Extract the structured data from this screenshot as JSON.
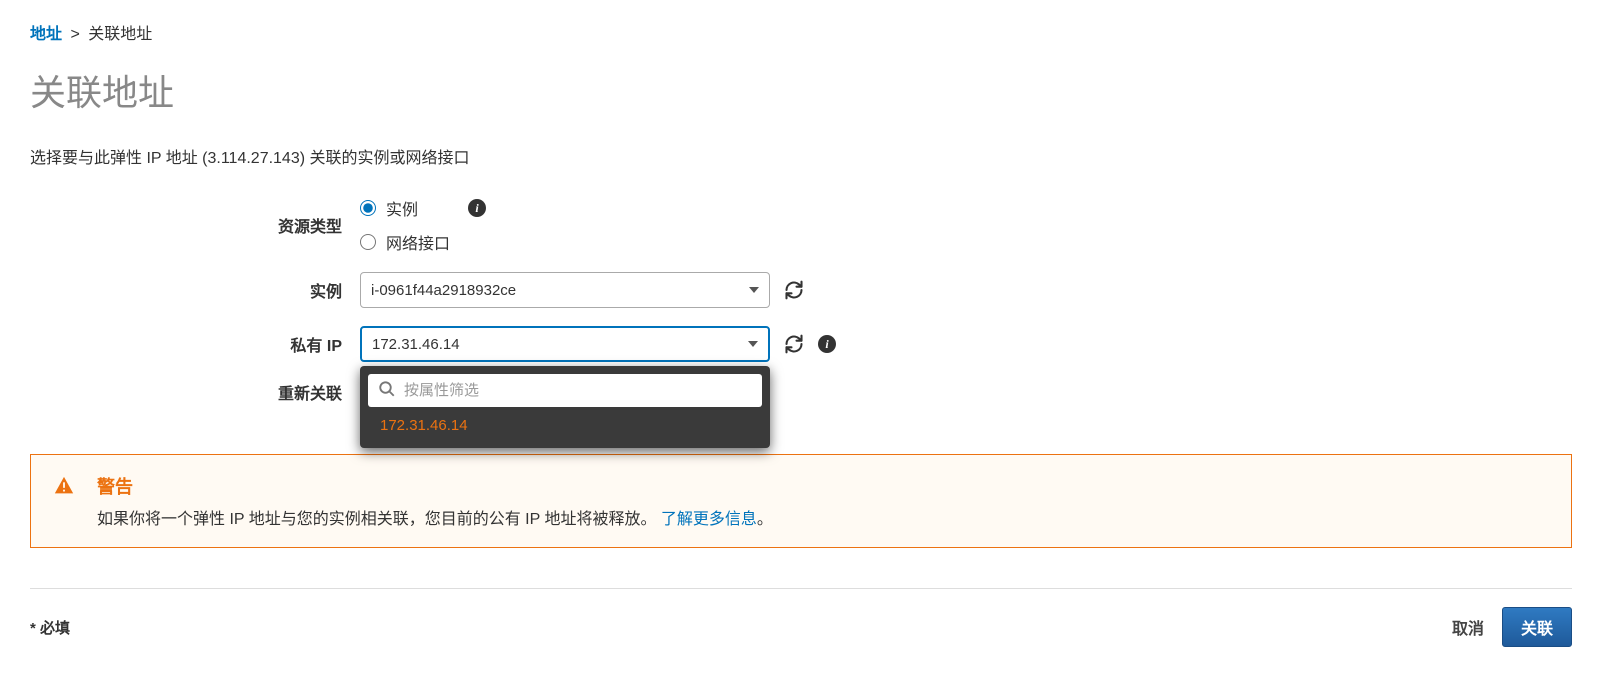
{
  "breadcrumb": {
    "root": "地址",
    "current": "关联地址"
  },
  "page_title": "关联地址",
  "description": "选择要与此弹性 IP 地址 (3.114.27.143) 关联的实例或网络接口",
  "form": {
    "resource_type": {
      "label": "资源类型",
      "options": {
        "instance": "实例",
        "network_interface": "网络接口"
      },
      "selected": "instance"
    },
    "instance": {
      "label": "实例",
      "value": "i-0961f44a2918932ce"
    },
    "private_ip": {
      "label": "私有 IP",
      "value": "172.31.46.14",
      "search_placeholder": "按属性筛选",
      "dropdown_options": [
        "172.31.46.14"
      ]
    },
    "reassociate": {
      "label": "重新关联"
    }
  },
  "warning": {
    "title": "警告",
    "text": "如果你将一个弹性 IP 地址与您的实例相关联，您目前的公有 IP 地址将被释放。",
    "link_text": "了解更多信息",
    "suffix": "。"
  },
  "footer": {
    "required_note": "* 必填",
    "cancel": "取消",
    "submit": "关联"
  }
}
